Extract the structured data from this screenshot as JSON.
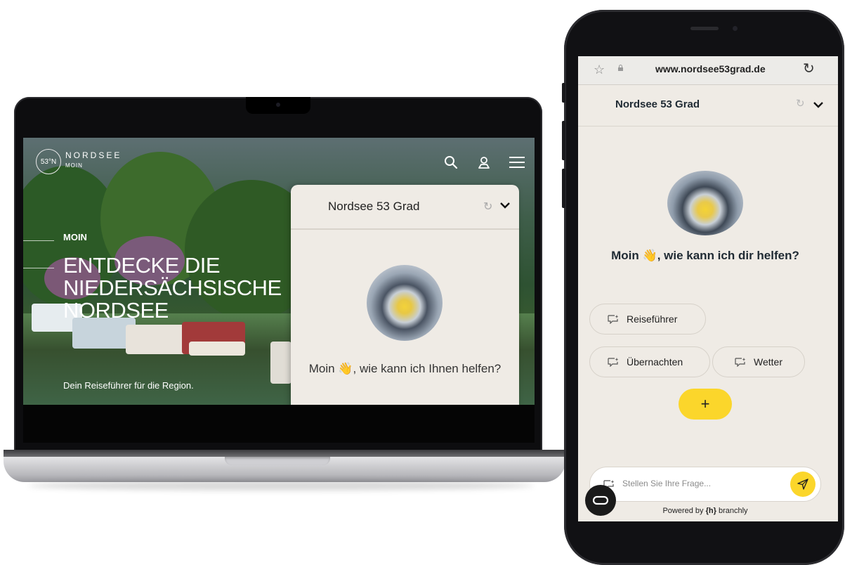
{
  "laptop": {
    "site": {
      "logo_badge": "53°N",
      "logo_name": "NORDSEE",
      "logo_sub": "MOIN",
      "hero_kicker": "MOIN",
      "hero_title": "ENTDECKE DIE NIEDERSÄCHSISCHE NORDSEE",
      "hero_subtitle": "Dein Reiseführer für die Region."
    },
    "chat": {
      "title": "Nordsee 53 Grad",
      "reset_glyph": "↻",
      "greeting_prefix": "Moin",
      "greeting_emoji": "👋",
      "greeting_suffix": ", wie kann ich Ihnen helfen?"
    }
  },
  "phone": {
    "browser": {
      "url": "www.nordsee53grad.de",
      "star_glyph": "☆",
      "reload_glyph": "↻"
    },
    "chat": {
      "title": "Nordsee 53 Grad",
      "reset_glyph": "↻",
      "greeting_prefix": "Moin",
      "greeting_emoji": "👋",
      "greeting_suffix": ", wie kann ich dir helfen?",
      "suggestions": [
        "Reiseführer",
        "Übernachten",
        "Wetter"
      ],
      "plus_label": "+",
      "input_placeholder": "Stellen Sie Ihre Frage...",
      "powered_prefix": "Powered by",
      "powered_brand": "branchly"
    }
  },
  "colors": {
    "accent_yellow": "#fbd62b",
    "chat_bg": "#efebe5",
    "device_black": "#111114"
  }
}
